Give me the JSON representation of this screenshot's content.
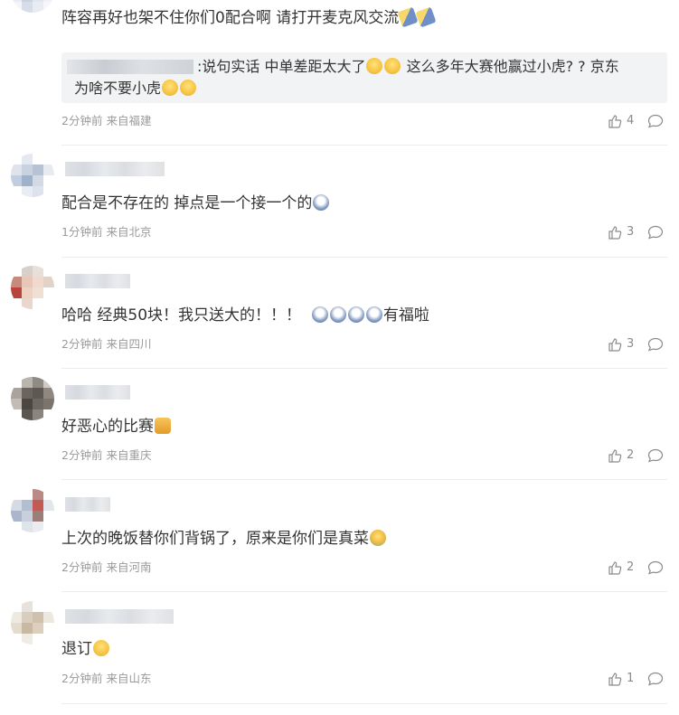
{
  "comments": [
    {
      "text": "阵容再好也架不住你们0配合啊 请打开麦克风交流",
      "reply_line1": ":说句实话 中单差距太大了",
      "reply_line1b": " 这么多年大赛他赢过小虎? ? 京东",
      "reply_line2": "为啥不要小虎",
      "time": "2分钟前",
      "location": "来自福建",
      "likes": "4"
    },
    {
      "text": "配合是不存在的 掉点是一个接一个的",
      "time": "1分钟前",
      "location": "来自北京",
      "likes": "3"
    },
    {
      "text": "哈哈 经典50块！我只送大的！！！",
      "text_b": "有福啦",
      "time": "2分钟前",
      "location": "来自四川",
      "likes": "3"
    },
    {
      "text": "好恶心的比赛",
      "time": "2分钟前",
      "location": "来自重庆",
      "likes": "2"
    },
    {
      "text": "上次的晚饭替你们背锅了，原来是你们是真菜",
      "time": "2分钟前",
      "location": "来自河南",
      "likes": "2"
    },
    {
      "text": "退订",
      "time": "2分钟前",
      "location": "来自山东",
      "likes": "1"
    }
  ],
  "icons": {
    "like": "thumbs-up-icon",
    "reply": "speech-bubble-icon"
  },
  "colors": {
    "text": "#333333",
    "meta": "#9a9a9a",
    "reply_bg": "#f2f3f5"
  }
}
